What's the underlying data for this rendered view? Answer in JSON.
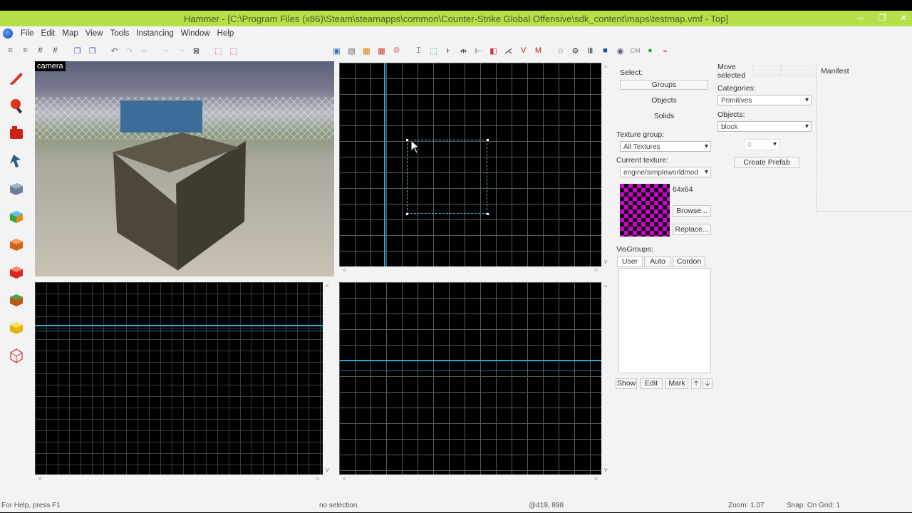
{
  "window": {
    "title": "Hammer - [C:\\Program Files (x86)\\Steam\\steamapps\\common\\Counter-Strike Global Offensive\\sdk_content\\maps\\testmap.vmf - Top]",
    "controls": [
      "─",
      "❐",
      "✕"
    ]
  },
  "menu": [
    "File",
    "Edit",
    "Map",
    "View",
    "Tools",
    "Instancing",
    "Window",
    "Help"
  ],
  "toolbar_icons": [
    "grid-small-icon",
    "grid-large-icon",
    "grid-toggle-icon",
    "grid-3d-icon",
    "copy-icon",
    "paste-icon",
    "undo-icon",
    "redo-icon",
    "cut-icon",
    "group-icon",
    "ungroup-icon",
    "hide-icon",
    "selection-icon",
    "carve-icon",
    "texture-lock-icon",
    "toggle-helpers-icon",
    "run-map-icon",
    "entity-report-icon",
    "check-problems-icon",
    "cordon-icon",
    "green-ball-icon",
    "brush-icon"
  ],
  "tools": [
    "selection-tool-icon",
    "magnify-tool-icon",
    "camera-tool-icon",
    "entity-tool-icon",
    "block-tool-icon",
    "texture-application-icon",
    "apply-texture-icon",
    "decal-tool-icon",
    "overlay-tool-icon",
    "clipping-tool-icon",
    "vertex-tool-icon"
  ],
  "viewports": {
    "camera_label": "camera"
  },
  "select_panel": {
    "heading": "Select:",
    "groups": "Groups",
    "objects": "Objects",
    "solids": "Solids",
    "texture_group_label": "Texture group:",
    "texture_group_value": "All Textures",
    "current_texture_label": "Current texture:",
    "current_texture_value": "engine/simpleworldmod",
    "texture_size": "64x64",
    "browse": "Browse...",
    "replace": "Replace...",
    "visgroups_label": "VisGroups:",
    "tabs": [
      "User",
      "Auto",
      "Cordon"
    ],
    "show": "Show",
    "edit": "Edit",
    "mark": "Mark"
  },
  "object_panel": {
    "move_selected": "Move selected",
    "categories_label": "Categories:",
    "categories_value": "Primitives",
    "objects_label": "Objects:",
    "objects_value": "block",
    "faces_value": "0",
    "create_prefab": "Create Prefab",
    "manifest_label": "Manifest"
  },
  "status": {
    "help": "For Help, press F1",
    "selection": "no selection.",
    "coords": "@419, 898",
    "zoom": "Zoom: 1.07",
    "snap": "Snap: On Grid: 1"
  }
}
